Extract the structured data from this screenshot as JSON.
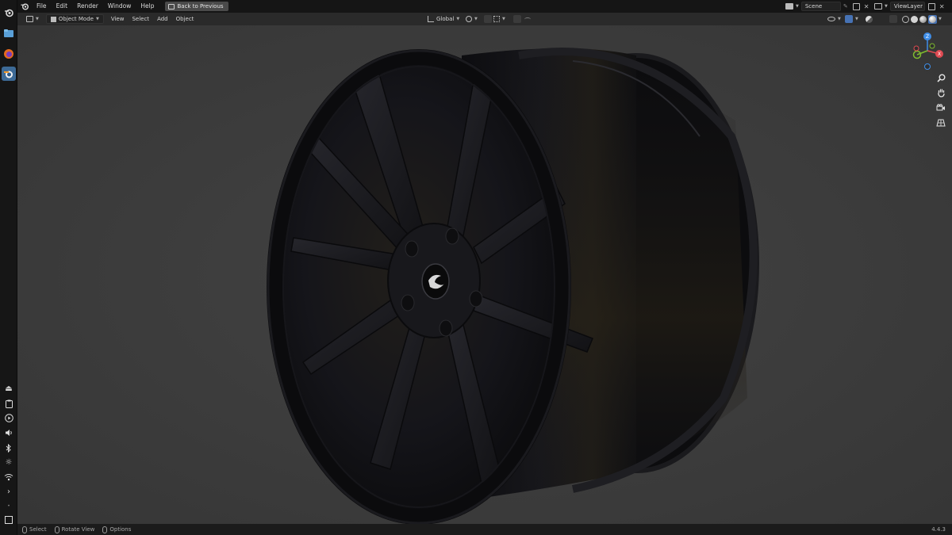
{
  "menu": {
    "items": [
      "File",
      "Edit",
      "Render",
      "Window",
      "Help"
    ],
    "back_button": "Back to Previous"
  },
  "top_right": {
    "scene": "Scene",
    "view_layer": "ViewLayer"
  },
  "viewport_header": {
    "mode": "Object Mode",
    "view": "View",
    "select": "Select",
    "add": "Add",
    "object": "Object",
    "orientation": "Global"
  },
  "gizmo": {
    "x": "X",
    "y": "Y",
    "z": "Z",
    "colors": {
      "x": "#e04a52",
      "y": "#7fbb2e",
      "z": "#3f8ee8"
    }
  },
  "status": {
    "select": "Select",
    "rotate": "Rotate View",
    "options": "Options",
    "version": "4.4.3"
  },
  "dock": {
    "icons": [
      "blender-icon",
      "files-icon",
      "firefox-icon",
      "blender-active-icon"
    ],
    "tray": [
      "eject-icon",
      "clipboard-icon",
      "play-icon",
      "volume-icon",
      "bluetooth-icon",
      "brightness-icon",
      "wifi-icon",
      "chevron-icon",
      "dot-icon",
      "window-icon"
    ]
  }
}
